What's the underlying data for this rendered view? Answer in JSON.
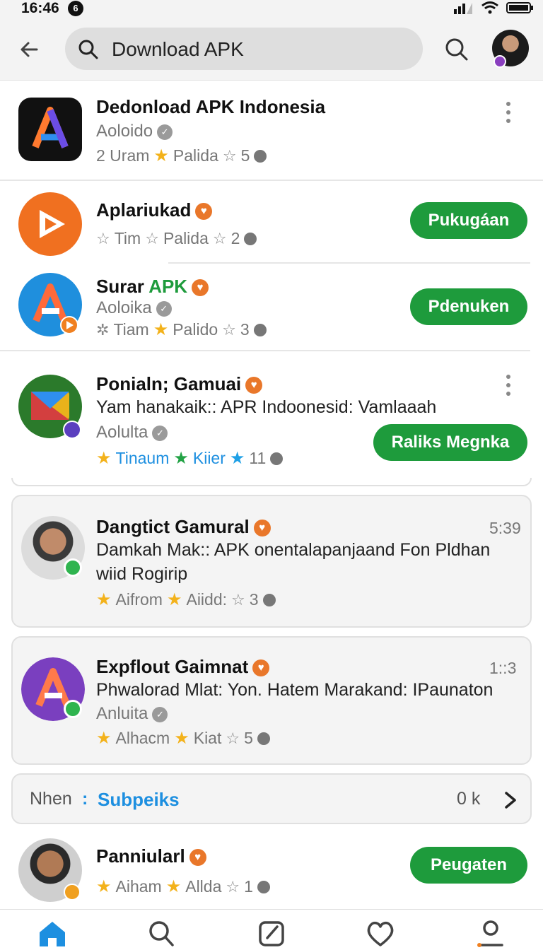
{
  "status": {
    "time": "16:46",
    "notif_count": "6"
  },
  "topbar": {
    "search_value": "Download APK"
  },
  "items": [
    {
      "title": "Dedonload APK Indonesia",
      "sub": "Aoloido",
      "meta": [
        "2 Uram",
        "Palida",
        "5"
      ]
    },
    {
      "title": "Aplariukad",
      "meta": [
        "Tim",
        "Palida",
        "2"
      ],
      "button": "Pukugáan"
    },
    {
      "title_pre": "Surar ",
      "title_accent": "APK",
      "sub": "Aoloika",
      "meta": [
        "Tiam",
        "Palido",
        "3"
      ],
      "button": "Pdenuken"
    },
    {
      "title": "Ponialn; Gamuai",
      "desc": "Yam hanakaik:: APR Indoonesid: Vamlaaah",
      "sub": "Aolulta",
      "meta": [
        "Tinaum",
        "Kiier",
        "11"
      ],
      "button": "Raliks Megnka"
    }
  ],
  "cards": [
    {
      "title": "Dangtict Gamural",
      "time": "5:39",
      "desc_line1": "Damkah Mak:: APK onentalapanjaand Fon Pldhan",
      "desc_line2": "wiid Rogirip",
      "meta": [
        "Aifrom",
        "Aiidd:",
        "3"
      ]
    },
    {
      "title": "Expflout Gaimnat",
      "time": "1::3",
      "desc_line1": "Phwalorad Mlat: Yon. Hatem Marakand: IPaunaton",
      "sub": "Anluita",
      "meta": [
        "Alhacm",
        "Kiat",
        "5"
      ]
    }
  ],
  "see_all": {
    "label": "Nhen",
    "sep": ":",
    "link": "Subpeiks",
    "count": "0 k"
  },
  "last": {
    "title": "Panniularl",
    "meta": [
      "Aiham",
      "Allda",
      "1"
    ],
    "button": "Peugaten"
  },
  "colors": {
    "primary_button": "#1e9b3c",
    "badge": "#e9772a",
    "link": "#1d8fe0",
    "star": "#f3b21b",
    "nav_active": "#1d8fe0"
  },
  "nav": [
    "home-icon",
    "search-icon",
    "edit-icon",
    "heart-icon",
    "profile-icon"
  ]
}
